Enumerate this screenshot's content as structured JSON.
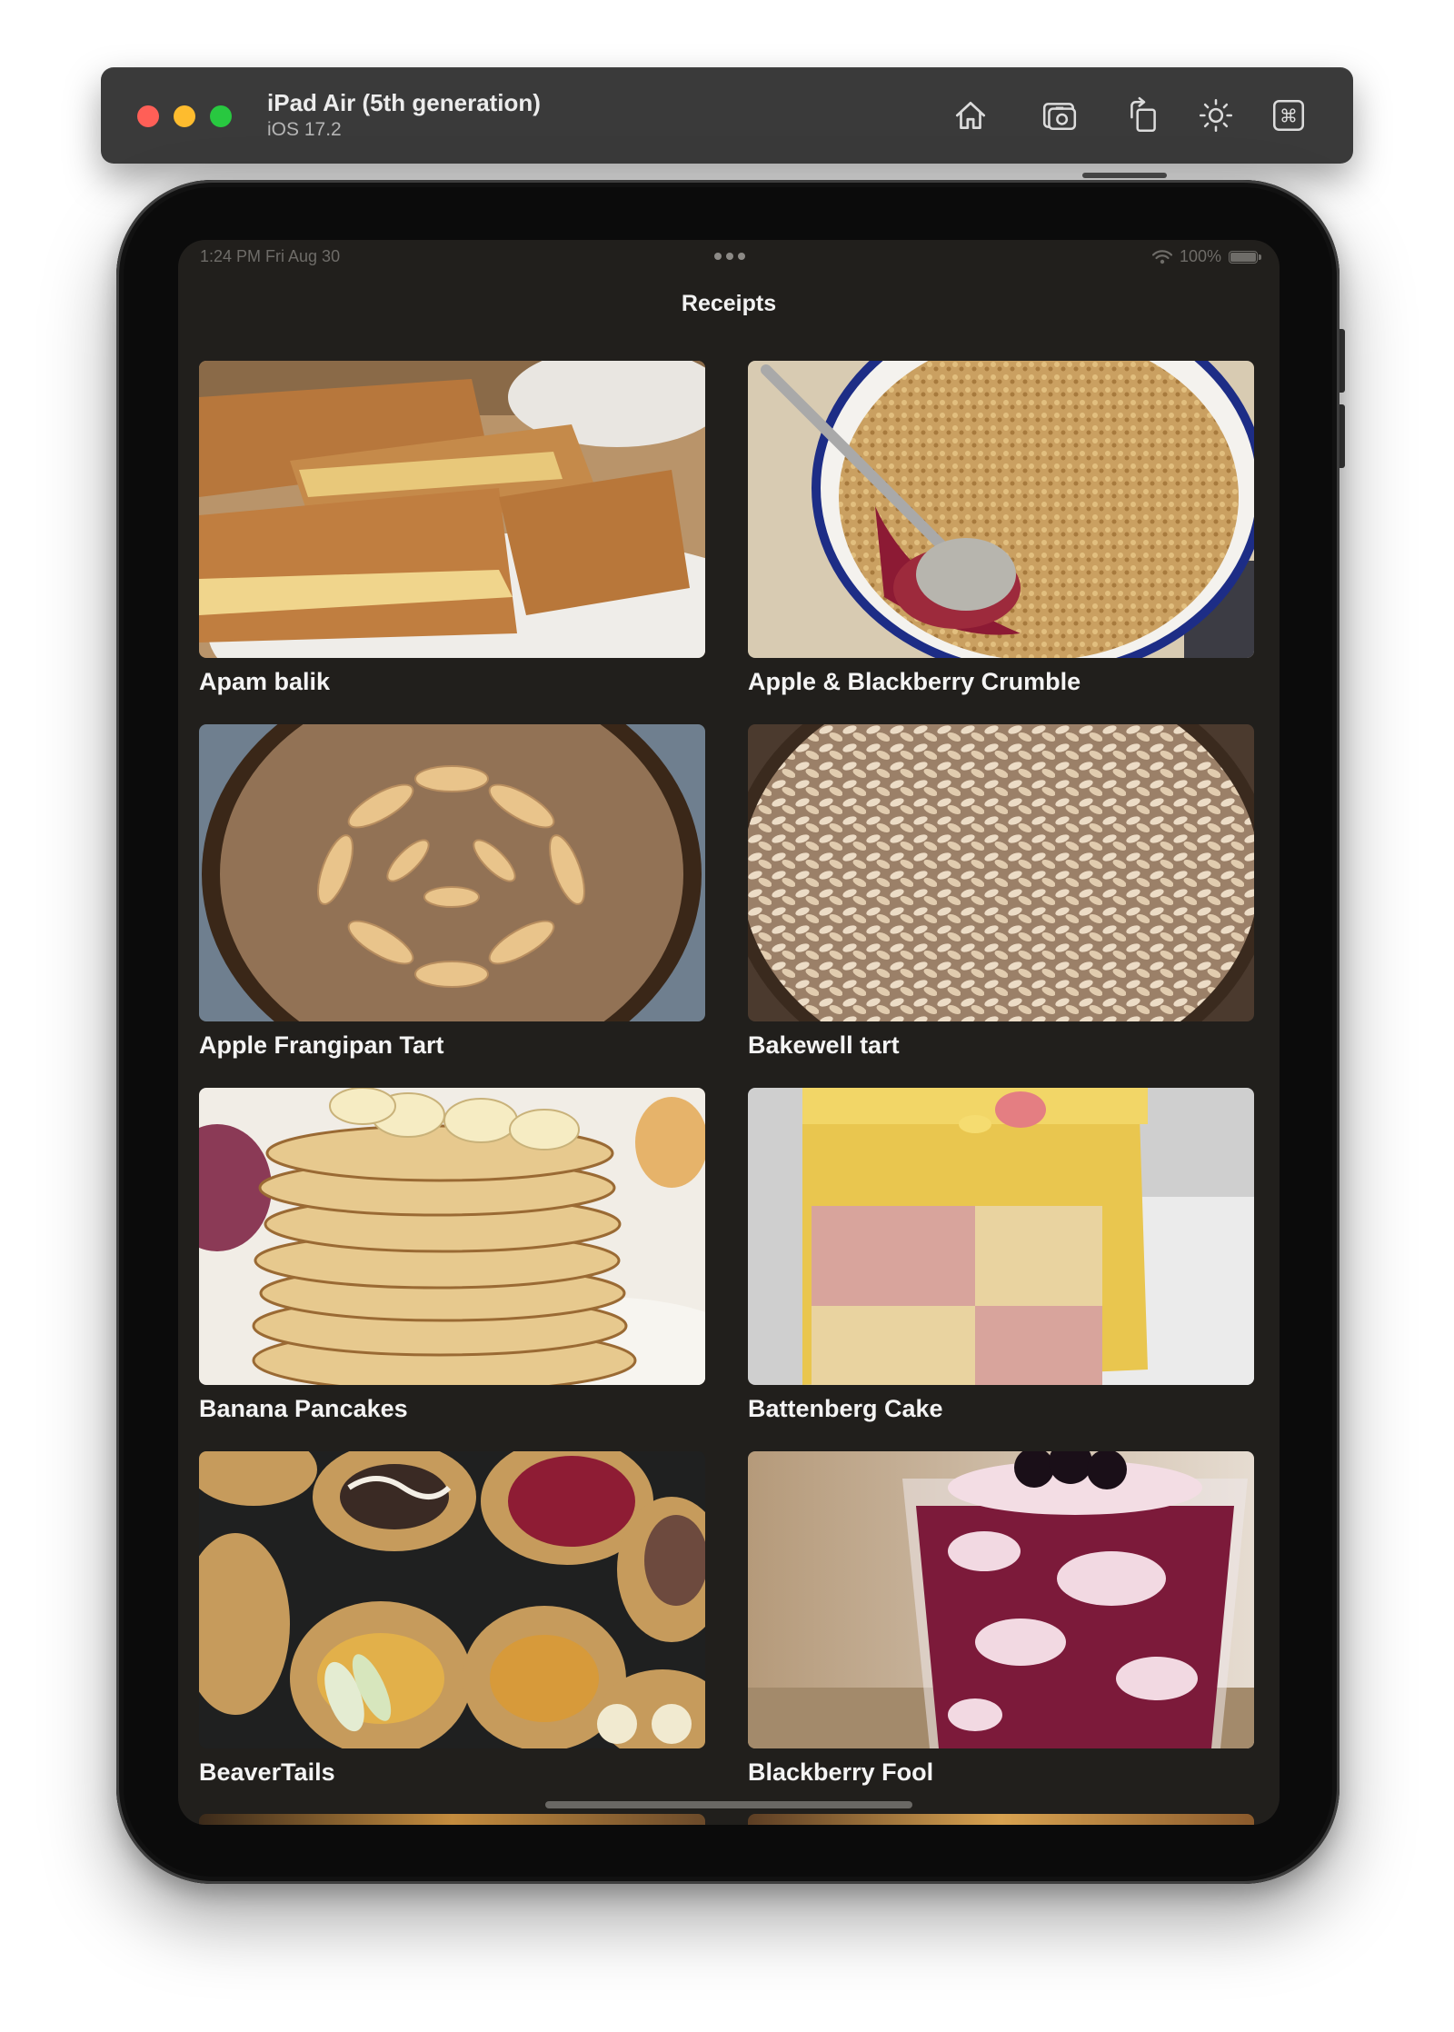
{
  "simulator": {
    "device_name": "iPad Air (5th generation)",
    "os_version": "iOS 17.2",
    "toolbar_icons": [
      "home-icon",
      "screenshot-icon",
      "rotate-icon",
      "appearance-icon",
      "command-icon"
    ]
  },
  "status_bar": {
    "time_date": "1:24 PM   Fri Aug 30",
    "battery": "100%"
  },
  "nav": {
    "title": "Receipts"
  },
  "recipes": [
    {
      "name": "Apam balik"
    },
    {
      "name": "Apple & Blackberry Crumble"
    },
    {
      "name": "Apple Frangipan Tart"
    },
    {
      "name": "Bakewell tart"
    },
    {
      "name": "Banana Pancakes"
    },
    {
      "name": "Battenberg Cake"
    },
    {
      "name": "BeaverTails"
    },
    {
      "name": "Blackberry Fool"
    }
  ],
  "colors": {
    "screen_background": "#211f1c",
    "toolbar_background": "#3a3a3a",
    "label_text": "#f4f4f4"
  }
}
